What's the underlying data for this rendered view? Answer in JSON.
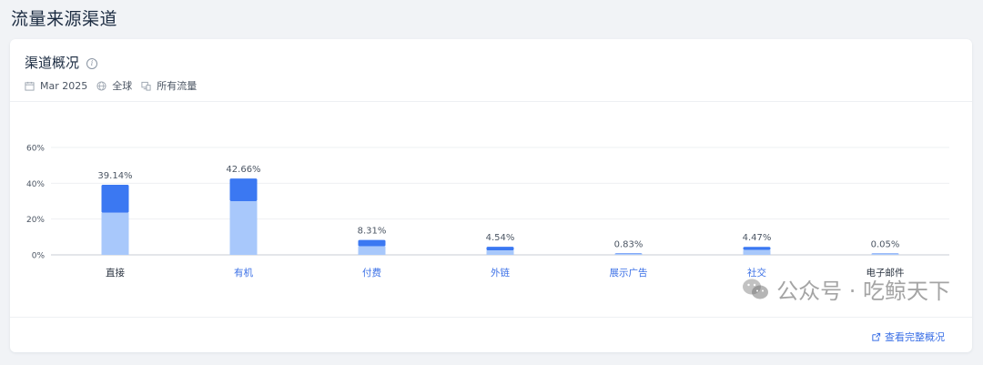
{
  "page": {
    "title": "流量来源渠道"
  },
  "card": {
    "title": "渠道概况",
    "meta": {
      "date": "Mar 2025",
      "region": "全球",
      "traffic": "所有流量"
    },
    "footer_link": "查看完整概况"
  },
  "watermark": {
    "text": "公众号 · 吃鲸天下"
  },
  "colors": {
    "dark": "#3b78f2",
    "light": "#a8c8fb",
    "category_text": "#3a6fe6",
    "category_text_default": "#2a3340"
  },
  "chart_data": {
    "type": "bar",
    "stacked": true,
    "categories": [
      "直接",
      "有机",
      "付费",
      "外链",
      "展示广告",
      "社交",
      "电子邮件"
    ],
    "values": [
      39.14,
      42.66,
      8.31,
      4.54,
      0.83,
      4.47,
      0.05
    ],
    "value_labels": [
      "39.14%",
      "42.66%",
      "8.31%",
      "4.54%",
      "0.83%",
      "4.47%",
      "0.05%"
    ],
    "series": [
      {
        "values": [
          23.5,
          30.0,
          4.8,
          2.5,
          0.5,
          2.8,
          0.03
        ]
      },
      {
        "values": [
          15.64,
          12.66,
          3.51,
          2.04,
          0.33,
          1.67,
          0.02
        ]
      }
    ],
    "yticks": [
      "0%",
      "20%",
      "40%",
      "60%"
    ],
    "ylim": [
      0,
      60
    ],
    "grid": true,
    "highlight_category": "直接"
  }
}
